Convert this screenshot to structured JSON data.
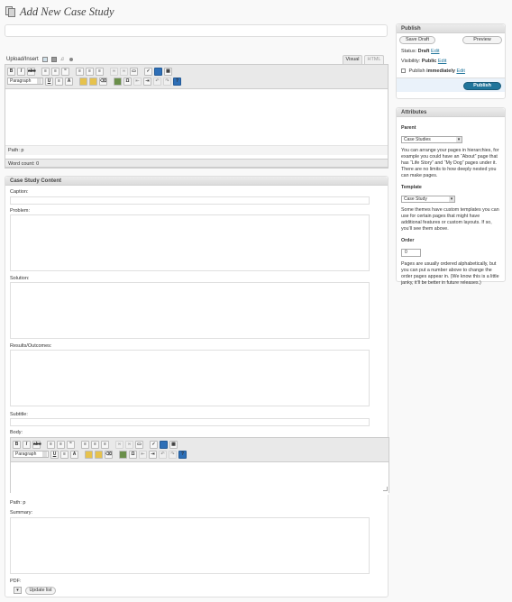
{
  "page_title": "Add New Case Study",
  "media": {
    "label": "Upload/Insert",
    "icons": [
      "image-icon",
      "video-icon",
      "audio-icon",
      "media-icon"
    ]
  },
  "tabs": {
    "visual": "Visual",
    "html": "HTML"
  },
  "editor": {
    "format_select": "Paragraph",
    "path": "Path: p",
    "word_count": "Word count: 0"
  },
  "publish": {
    "title": "Publish",
    "save_draft": "Save Draft",
    "preview": "Preview",
    "status_label": "Status:",
    "status_value": "Draft",
    "visibility_label": "Visibility:",
    "visibility_value": "Public",
    "publish_label": "Publish",
    "publish_value": "immediately",
    "edit": "Edit",
    "publish_button": "Publish"
  },
  "attributes": {
    "title": "Attributes",
    "parent_label": "Parent",
    "parent_value": "Case Studies",
    "parent_help": "You can arrange your pages in hierarchies, for example you could have an “About” page that has “Life Story” and “My Dog” pages under it. There are no limits to how deeply nested you can make pages.",
    "template_label": "Template",
    "template_value": "Case Study",
    "template_help": "Some themes have custom templates you can use for certain pages that might have additional features or custom layouts. If so, you’ll see them above.",
    "order_label": "Order",
    "order_value": "0",
    "order_help": "Pages are usually ordered alphabetically, but you can put a number above to change the order pages appear in. (We know this is a little janky, it’ll be better in future releases.)"
  },
  "case_study": {
    "title": "Case Study Content",
    "caption_label": "Caption:",
    "problem_label": "Problem:",
    "solution_label": "Solution:",
    "results_label": "Results/Outcomes:",
    "subtitle_label": "Subtitle:",
    "body_label": "Body:",
    "body_path": "Path: p",
    "summary_label": "Summary:",
    "pdf_label": "PDF:",
    "update_list": "Update list"
  }
}
